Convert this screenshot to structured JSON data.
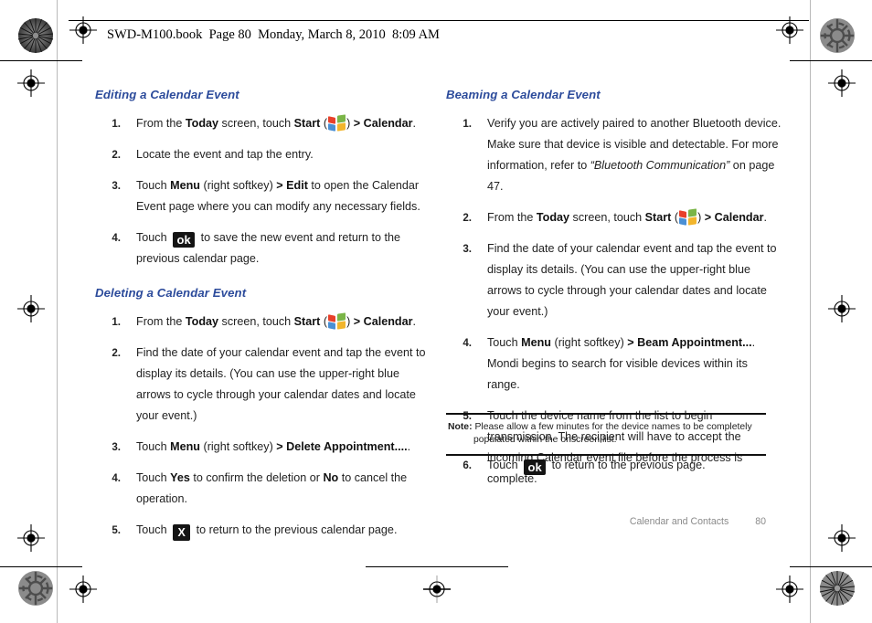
{
  "header": {
    "text": "SWD-M100.book  Page 80  Monday, March 8, 2010  8:09 AM"
  },
  "footer": {
    "chapter": "Calendar and Contacts",
    "page_number": "80"
  },
  "colors": {
    "heading_blue": "#2c4b9b",
    "body_text": "#222222",
    "footer_gray": "#8a8a8a",
    "key_black": "#141414",
    "flag_red": "#e8402a",
    "flag_green": "#7ab547",
    "flag_blue": "#4a8fd4",
    "flag_yellow": "#f2b52c"
  },
  "left_column": {
    "sections": [
      {
        "heading": "Editing a Calendar Event",
        "steps": [
          {
            "num": "1.",
            "parts": [
              {
                "t": "From the ",
                "s": "n"
              },
              {
                "t": "Today",
                "s": "b"
              },
              {
                "t": " screen, touch ",
                "s": "n"
              },
              {
                "t": "Start",
                "s": "b"
              },
              {
                "t": " (",
                "s": "n"
              },
              {
                "t": "",
                "s": "winflag"
              },
              {
                "t": ") ",
                "s": "n"
              },
              {
                "t": "> Calendar",
                "s": "b"
              },
              {
                "t": ".",
                "s": "n"
              }
            ]
          },
          {
            "num": "2.",
            "parts": [
              {
                "t": "Locate the event and tap the entry.",
                "s": "n"
              }
            ]
          },
          {
            "num": "3.",
            "parts": [
              {
                "t": "Touch ",
                "s": "n"
              },
              {
                "t": "Menu",
                "s": "b"
              },
              {
                "t": " (right softkey) ",
                "s": "n"
              },
              {
                "t": "> Edit",
                "s": "b"
              },
              {
                "t": " to open the Calendar Event page where you can modify any necessary fields.",
                "s": "n"
              }
            ]
          },
          {
            "num": "4.",
            "parts": [
              {
                "t": "Touch ",
                "s": "n"
              },
              {
                "t": "ok",
                "s": "key-ok"
              },
              {
                "t": " to save the new event and return to the previous calendar page.",
                "s": "n"
              }
            ]
          }
        ]
      },
      {
        "heading": "Deleting a Calendar Event",
        "steps": [
          {
            "num": "1.",
            "parts": [
              {
                "t": "From the ",
                "s": "n"
              },
              {
                "t": "Today",
                "s": "b"
              },
              {
                "t": " screen, touch ",
                "s": "n"
              },
              {
                "t": "Start",
                "s": "b"
              },
              {
                "t": " (",
                "s": "n"
              },
              {
                "t": "",
                "s": "winflag"
              },
              {
                "t": ") ",
                "s": "n"
              },
              {
                "t": "> Calendar",
                "s": "b"
              },
              {
                "t": ".",
                "s": "n"
              }
            ]
          },
          {
            "num": "2.",
            "parts": [
              {
                "t": "Find the date of your calendar event and tap the event to display its details. (You can use the upper-right blue arrows to cycle through your calendar dates and locate your event.)",
                "s": "n"
              }
            ]
          },
          {
            "num": "3.",
            "parts": [
              {
                "t": "Touch ",
                "s": "n"
              },
              {
                "t": "Menu",
                "s": "b"
              },
              {
                "t": " (right softkey) ",
                "s": "n"
              },
              {
                "t": "> Delete Appointment....",
                "s": "b"
              },
              {
                "t": ".",
                "s": "n"
              }
            ]
          },
          {
            "num": "4.",
            "parts": [
              {
                "t": "Touch ",
                "s": "n"
              },
              {
                "t": "Yes",
                "s": "b"
              },
              {
                "t": " to confirm the deletion or ",
                "s": "n"
              },
              {
                "t": "No",
                "s": "b"
              },
              {
                "t": " to cancel the operation.",
                "s": "n"
              }
            ]
          },
          {
            "num": "5.",
            "parts": [
              {
                "t": "Touch ",
                "s": "n"
              },
              {
                "t": "X",
                "s": "key-x"
              },
              {
                "t": " to return to the previous calendar page.",
                "s": "n"
              }
            ]
          }
        ]
      }
    ]
  },
  "right_column": {
    "sections": [
      {
        "heading": "Beaming a Calendar Event",
        "steps": [
          {
            "num": "1.",
            "parts": [
              {
                "t": "Verify you are actively paired to another Bluetooth device. Make sure that device is visible and detectable. For more information, refer to ",
                "s": "n"
              },
              {
                "t": "“Bluetooth Communication”",
                "s": "i"
              },
              {
                "t": "  on page 47.",
                "s": "n"
              }
            ]
          },
          {
            "num": "2.",
            "parts": [
              {
                "t": "From the ",
                "s": "n"
              },
              {
                "t": "Today",
                "s": "b"
              },
              {
                "t": " screen, touch ",
                "s": "n"
              },
              {
                "t": "Start",
                "s": "b"
              },
              {
                "t": " (",
                "s": "n"
              },
              {
                "t": "",
                "s": "winflag"
              },
              {
                "t": ") ",
                "s": "n"
              },
              {
                "t": "> Calendar",
                "s": "b"
              },
              {
                "t": ".",
                "s": "n"
              }
            ]
          },
          {
            "num": "3.",
            "parts": [
              {
                "t": "Find the date of your calendar event and tap the event to display its details. (You can use the upper-right blue arrows to cycle through your calendar dates and locate your event.)",
                "s": "n"
              }
            ]
          },
          {
            "num": "4.",
            "parts": [
              {
                "t": "Touch ",
                "s": "n"
              },
              {
                "t": "Menu",
                "s": "b"
              },
              {
                "t": " (right softkey) ",
                "s": "n"
              },
              {
                "t": "> Beam Appointment...",
                "s": "b"
              },
              {
                "t": ". Mondi begins to search for visible devices within its range.",
                "s": "n"
              }
            ]
          },
          {
            "num": "5.",
            "parts": [
              {
                "t": "Touch the device name from the list to begin transmission. The recipient will have to accept the incoming Calendar event file before the process is complete.",
                "s": "n"
              }
            ]
          }
        ]
      }
    ],
    "note": {
      "label": "Note:",
      "line1": "Please allow a few minutes for the device names to be completely",
      "line2": "populated within the onscreen list."
    },
    "after_note_steps": [
      {
        "num": "6.",
        "parts": [
          {
            "t": "Touch ",
            "s": "n"
          },
          {
            "t": "ok",
            "s": "key-ok"
          },
          {
            "t": " to return to the previous page.",
            "s": "n"
          }
        ]
      }
    ]
  }
}
